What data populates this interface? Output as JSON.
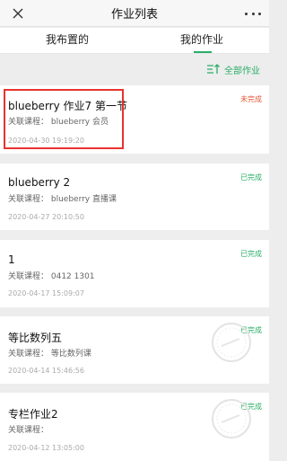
{
  "nav": {
    "title": "作业列表",
    "close_icon": "close-icon",
    "more_icon": "more-dots-icon"
  },
  "tabs": {
    "assigned": "我布置的",
    "mine": "我的作业",
    "active": "mine"
  },
  "filter": {
    "label": "全部作业",
    "icon": "sort-filter-icon"
  },
  "homework": [
    {
      "name": "blueberry 作业7 第一节",
      "course": "关联课程：  blueberry 会员",
      "time": "2020-04-30 19:19:20",
      "status": "未完成",
      "status_type": "undone",
      "highlighted": true
    },
    {
      "name": "blueberry 2",
      "course": "关联课程：  blueberry 直播课",
      "time": "2020-04-27 20:10:50",
      "status": "已完成",
      "status_type": "done"
    },
    {
      "name": "1",
      "course": "关联课程：  0412 1301",
      "time": "2020-04-17 15:09:07",
      "status": "已完成",
      "status_type": "done"
    },
    {
      "name": "等比数列五",
      "course": "关联课程：  等比数列课",
      "time": "2020-04-14 15:46:56",
      "status": "已完成",
      "status_type": "done",
      "stamp": true
    },
    {
      "name": "专栏作业2",
      "course": "关联课程：",
      "time": "2020-04-12 13:05:00",
      "status": "已完成",
      "status_type": "done",
      "stamp": true
    }
  ],
  "colors": {
    "accent": "#2aae67",
    "undone": "#e05a3c",
    "highlight_border": "#e8322f"
  }
}
